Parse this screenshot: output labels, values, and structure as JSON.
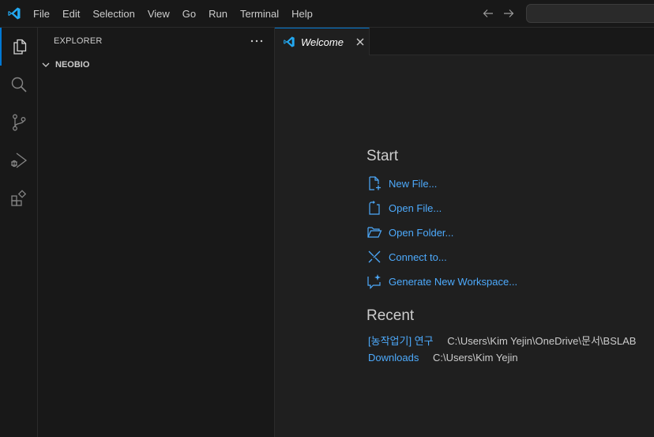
{
  "titlebar": {
    "menu": [
      "File",
      "Edit",
      "Selection",
      "View",
      "Go",
      "Run",
      "Terminal",
      "Help"
    ]
  },
  "sidebar": {
    "title": "EXPLORER",
    "folder": "NEOBIO"
  },
  "tabs": [
    {
      "label": "Welcome",
      "active": true
    }
  ],
  "welcome": {
    "start_heading": "Start",
    "start_items": [
      {
        "label": "New File...",
        "icon": "new-file-icon"
      },
      {
        "label": "Open File...",
        "icon": "open-file-icon"
      },
      {
        "label": "Open Folder...",
        "icon": "open-folder-icon"
      },
      {
        "label": "Connect to...",
        "icon": "remote-connect-icon"
      },
      {
        "label": "Generate New Workspace...",
        "icon": "sparkle-chat-icon"
      }
    ],
    "recent_heading": "Recent",
    "recent": [
      {
        "name": "[농작업기] 연구",
        "path": "C:\\Users\\Kim Yejin\\OneDrive\\문서\\BSLAB"
      },
      {
        "name": "Downloads",
        "path": "C:\\Users\\Kim Yejin"
      }
    ]
  },
  "colors": {
    "accent": "#0078d4",
    "link": "#4daafc",
    "logo": "#23a9f2",
    "background": "#1f1f1f",
    "chrome": "#181818"
  }
}
